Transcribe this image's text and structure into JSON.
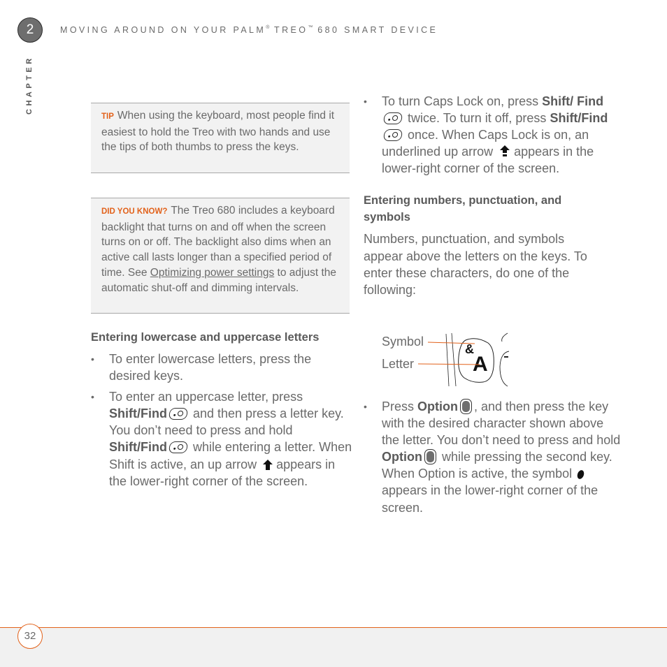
{
  "header": {
    "chapter_number": "2",
    "chapter_label": "CHAPTER",
    "title_part1": "MOVING AROUND ON YOUR PALM",
    "reg_mark": "®",
    "title_part2": " TREO",
    "tm_mark": "™",
    "title_part3": " 680 SMART DEVICE"
  },
  "left_column": {
    "tip": {
      "tag": "TIP",
      "text": "When using the keyboard, most people find it easiest to hold the Treo with two hands and use the tips of both thumbs to press the keys."
    },
    "did_you_know": {
      "tag": "DID YOU KNOW?",
      "text_before": "The Treo 680 includes a keyboard backlight that turns on and off when the screen turns on or off. The backlight also dims when an active call lasts longer than a specified period of time. See ",
      "link": "Optimizing power settings",
      "text_after": " to adjust the automatic shut-off and dimming intervals."
    },
    "section_heading": "Entering lowercase and uppercase letters",
    "bullets": [
      {
        "text": "To enter lowercase letters, press the desired keys."
      },
      {
        "t1": "To enter an uppercase letter, press ",
        "k1": "Shift/Find",
        "t2": " and then press a letter key. You don’t need to press and hold ",
        "k2": "Shift/Find",
        "t3": " while entering a letter. When Shift is active, an up arrow ",
        "t4": " appears in the lower-right corner of the screen."
      }
    ]
  },
  "right_column": {
    "caps_bullet": {
      "t1": "To turn Caps Lock on, press ",
      "k1": "Shift/ Find",
      "t2": " twice. To turn it off, press ",
      "k2": "Shift/Find",
      "t3": " once. When Caps Lock is on, an underlined up arrow ",
      "t4": " appears in the lower-right corner of the screen."
    },
    "section_heading": "Entering numbers, punctuation, and symbols",
    "intro": "Numbers, punctuation, and symbols appear above the letters on the keys. To enter these characters, do one of the following:",
    "figure": {
      "symbol_label": "Symbol",
      "letter_label": "Letter",
      "key_symbol": "&",
      "key_letter": "A",
      "accent_color": "#e2621b"
    },
    "option_bullet": {
      "t1": "Press ",
      "k1": "Option",
      "t2": ", and then press the key with the desired character shown above the letter. You don’t need to press and hold ",
      "k2": "Option",
      "t3": " while pressing the second key. When Option is active, the symbol ",
      "t4": " appears in the lower-right corner of the screen."
    }
  },
  "footer": {
    "page_number": "32",
    "accent_color": "#e2621b"
  }
}
